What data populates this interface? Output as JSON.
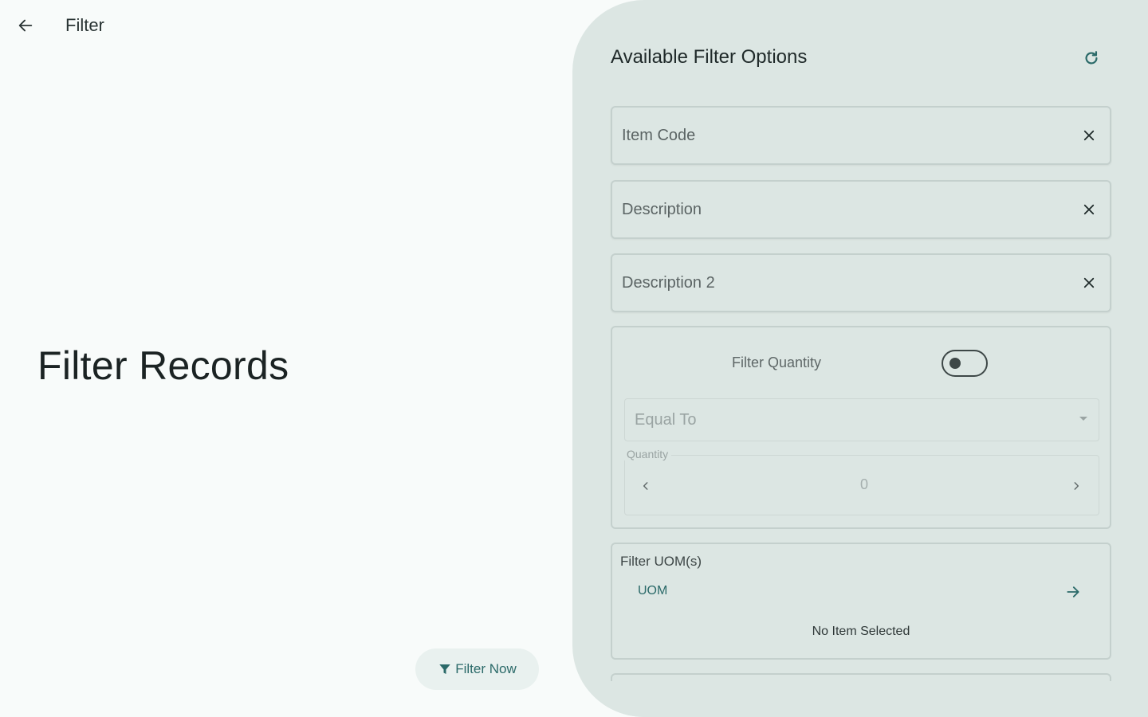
{
  "header": {
    "title": "Filter",
    "back_icon": "arrow-left-icon"
  },
  "left": {
    "heading": "Filter Records",
    "filter_now_label": "Filter Now",
    "filter_now_icon": "funnel-icon",
    "accent_color": "#2b6a69"
  },
  "panel": {
    "title": "Available Filter Options",
    "refresh_icon": "refresh-icon",
    "fields": [
      {
        "label": "Item Code"
      },
      {
        "label": "Description"
      },
      {
        "label": "Description 2"
      }
    ],
    "quantity": {
      "toggle_label": "Filter Quantity",
      "toggle_on": false,
      "operator": "Equal To",
      "stepper_label": "Quantity",
      "value": "0"
    },
    "uom": {
      "title": "Filter UOM(s)",
      "row_label": "UOM",
      "status": "No Item Selected"
    },
    "background_color": "#dce6e3"
  }
}
